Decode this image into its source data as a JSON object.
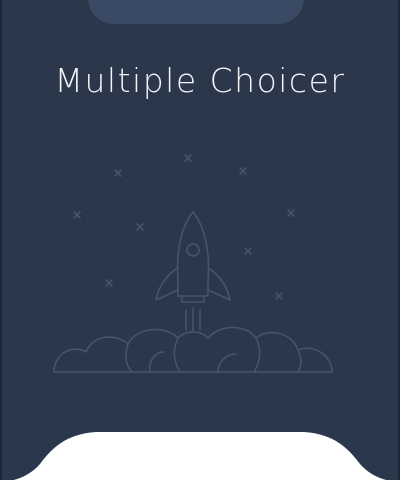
{
  "screen": {
    "title": "Multiple Choicer"
  },
  "colors": {
    "background": "#2b374a",
    "tab": "#3a4a65",
    "title_text": "#f2f4f7",
    "illustration_stroke": "#4a5870",
    "card": "#ffffff"
  },
  "illustration": {
    "icon": "rocket-launch-icon"
  }
}
